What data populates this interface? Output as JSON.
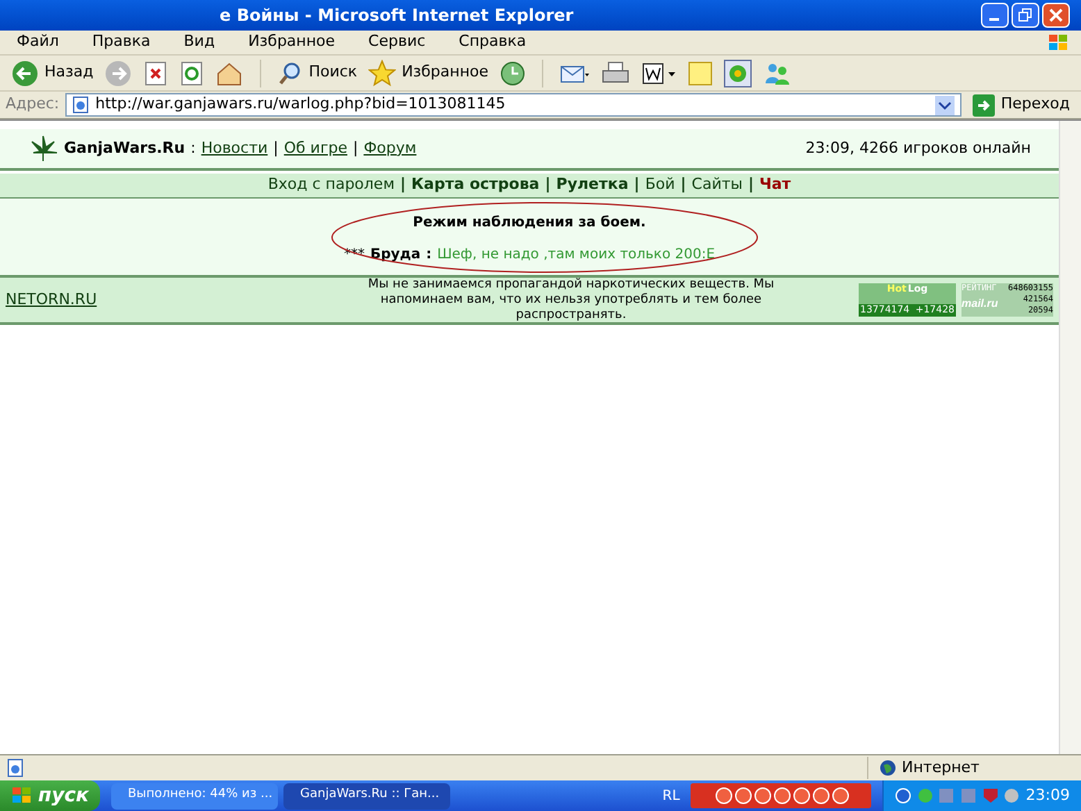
{
  "window": {
    "title": "е Войны - Microsoft Internet Explorer"
  },
  "menu": [
    "Файл",
    "Правка",
    "Вид",
    "Избранное",
    "Сервис",
    "Справка"
  ],
  "toolbar": {
    "back": "Назад",
    "search": "Поиск",
    "favorites": "Избранное"
  },
  "address": {
    "label": "Адрес:",
    "url": "http://war.ganjawars.ru/warlog.php?bid=1013081145",
    "go": "Переход"
  },
  "page": {
    "site": "GanjaWars.Ru",
    "sep": ":",
    "divider": "|",
    "links": [
      "Новости",
      "Об игре",
      "Форум"
    ],
    "online": "23:09, 4266 игроков онлайн",
    "nav": [
      {
        "label": "Вход с паролем",
        "bold": false,
        "red": false
      },
      {
        "label": "Карта острова",
        "bold": true,
        "red": false
      },
      {
        "label": "Рулетка",
        "bold": true,
        "red": false
      },
      {
        "label": "Бой",
        "bold": false,
        "red": false
      },
      {
        "label": "Сайты",
        "bold": false,
        "red": false
      },
      {
        "label": "Чат",
        "bold": true,
        "red": true
      }
    ],
    "heading": "Режим наблюдения за боем.",
    "log": {
      "prefix": "***",
      "name": "Бруда",
      "colon": ":",
      "message": "Шеф, не надо ,там моих только 200:Е"
    },
    "footer_link": "NETORN.RU",
    "disclaimer": "Мы не занимаемся пропагандой наркотических веществ. Мы напоминаем вам, что их нельзя употреблять и тем более распространять.",
    "hotlog": {
      "top": "Hot",
      "log": "Log",
      "count": "13774174",
      "delta": "+17428"
    },
    "mailru": {
      "label": "РЕЙТИНГ",
      "n1": "648603155",
      "n2": "421564",
      "n3": "20594",
      "logo": "mail.ru"
    }
  },
  "status_bar": {
    "zone": "Интернет"
  },
  "taskbar": {
    "start": "пуск",
    "tasks": [
      {
        "label": "Выполнено: 44% из ...",
        "selected": false
      },
      {
        "label": "GanjaWars.Ru :: Ган...",
        "selected": true
      }
    ],
    "lang": "RL",
    "clock": "23:09"
  }
}
